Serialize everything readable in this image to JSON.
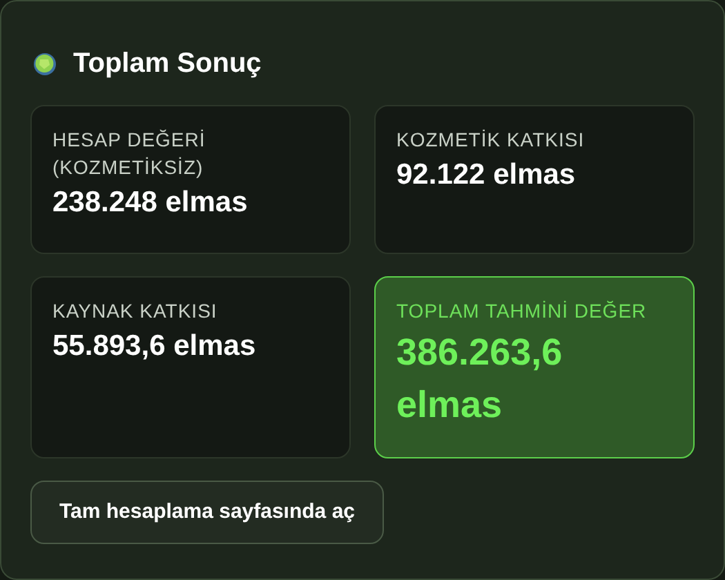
{
  "title": "Toplam Sonuç",
  "cards": [
    {
      "label": "HESAP DEĞERİ (KOZMETİKSİZ)",
      "value": "238.248 elmas",
      "highlighted": false
    },
    {
      "label": "KOZMETİK KATKISI",
      "value": "92.122 elmas",
      "highlighted": false
    },
    {
      "label": "KAYNAK KATKISI",
      "value": "55.893,6 elmas",
      "highlighted": false
    },
    {
      "label": "TOPLAM TAHMİNİ DEĞER",
      "value": "386.263,6 elmas",
      "highlighted": true
    }
  ],
  "button": "Tam hesaplama sayfasında aç"
}
